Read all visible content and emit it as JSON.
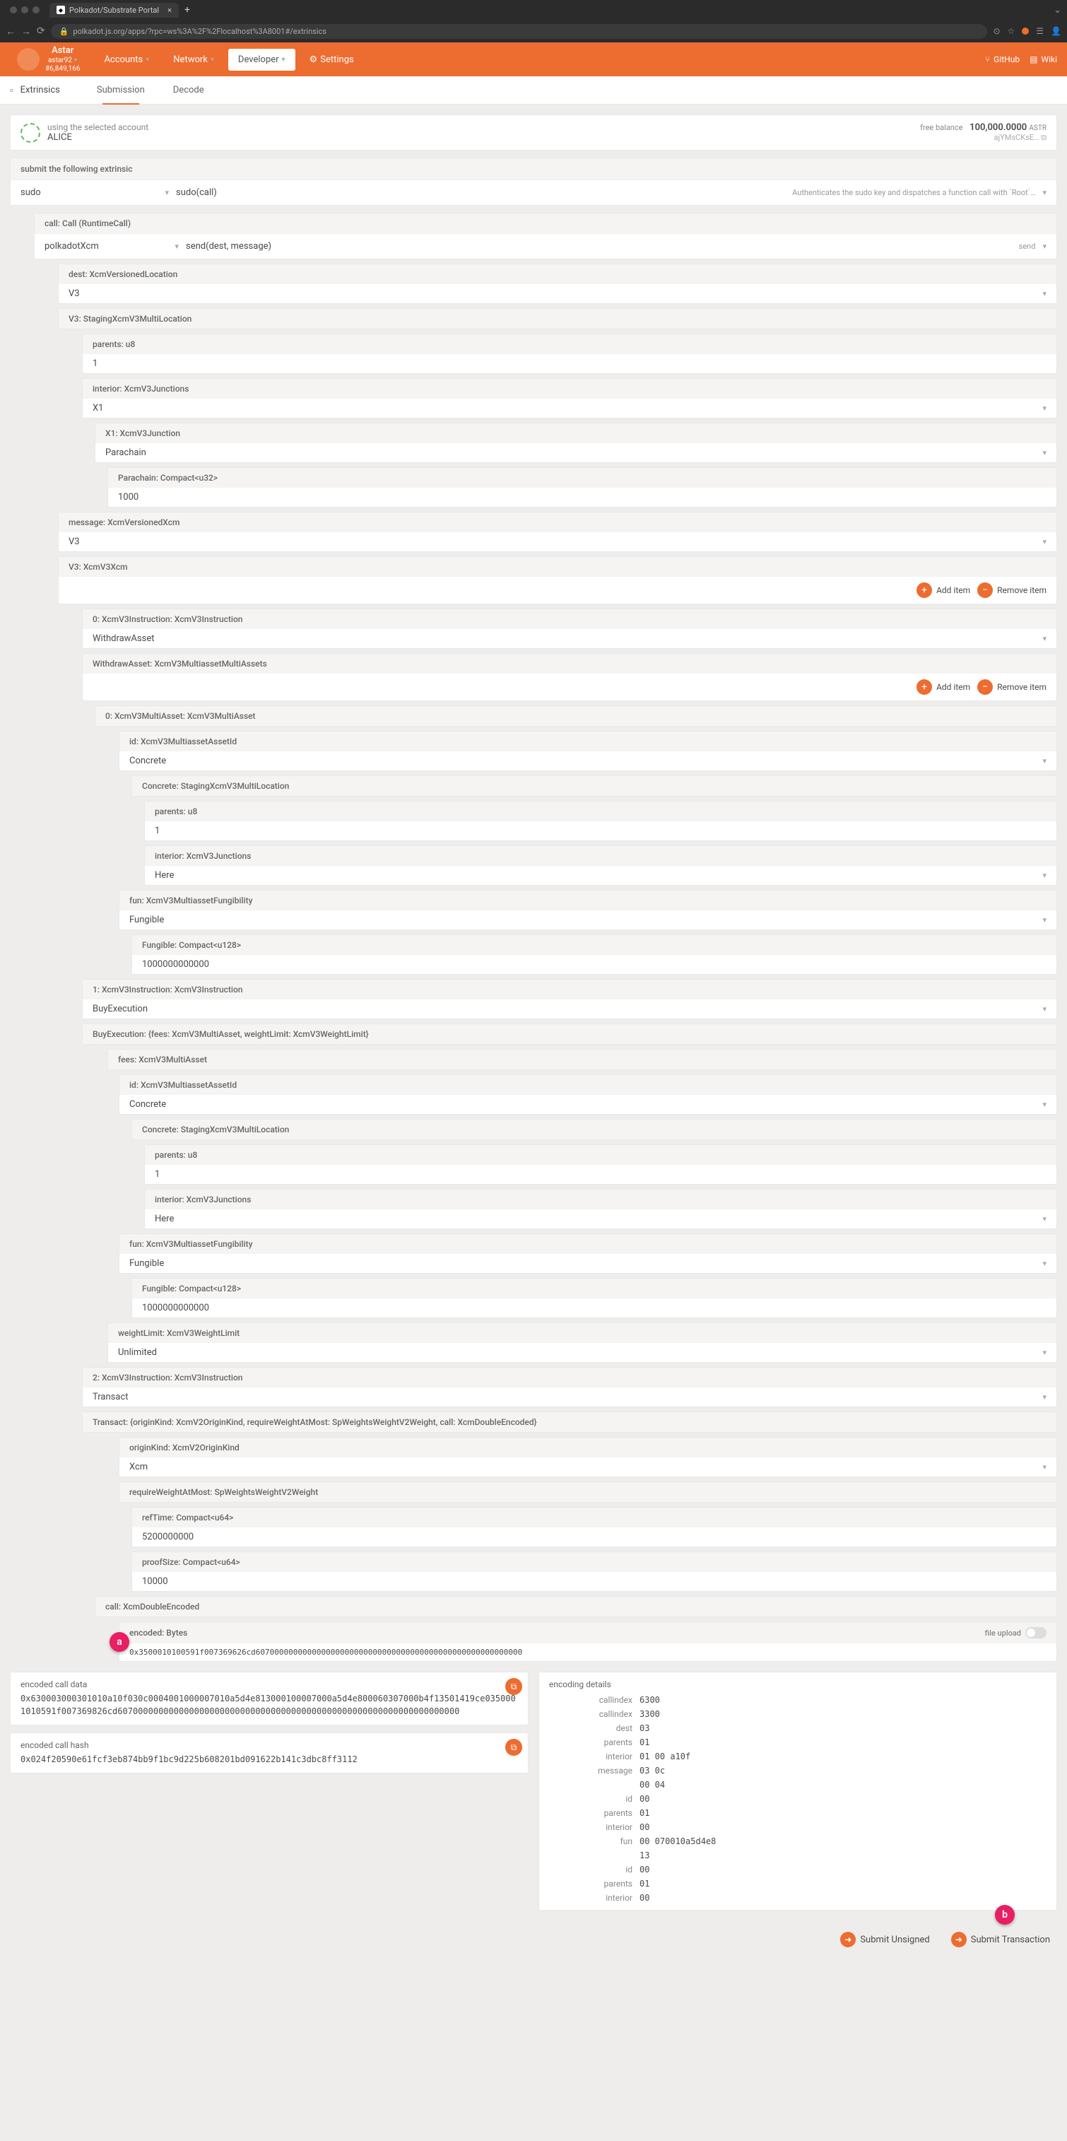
{
  "browser": {
    "tab_title": "Polkadot/Substrate Portal",
    "url": "polkadot.js.org/apps/?rpc=ws%3A%2F%2Flocalhost%3A8001#/extrinsics"
  },
  "nav": {
    "chain_name": "Astar",
    "chain_sub": "astar92",
    "block": "#6,849,166",
    "items": [
      "Accounts",
      "Network",
      "Developer",
      "Settings"
    ],
    "github": "GitHub",
    "wiki": "Wiki"
  },
  "subnav": {
    "label": "Extrinsics",
    "tabs": [
      "Submission",
      "Decode"
    ]
  },
  "account": {
    "label": "using the selected account",
    "name": "ALICE",
    "bal_label": "free balance",
    "bal_val": "100,000.0000",
    "bal_unit": "ASTR",
    "addr": "ajYMsCKsE…"
  },
  "form": {
    "header": "submit the following extrinsic",
    "module": "sudo",
    "method": "sudo(call)",
    "hint": "Authenticates the sudo key and dispatches a function call with `Root`…",
    "call_label": "call: Call (RuntimeCall)",
    "call_module": "polkadotXcm",
    "call_method": "send(dest, message)",
    "call_hint": "send"
  },
  "dest": {
    "label": "dest: XcmVersionedLocation",
    "value": "V3",
    "v3_label": "V3: StagingXcmV3MultiLocation",
    "parents_label": "parents: u8",
    "parents_val": "1",
    "interior_label": "interior: XcmV3Junctions",
    "interior_val": "X1",
    "x1_label": "X1: XcmV3Junction",
    "x1_val": "Parachain",
    "para_label": "Parachain: Compact<u32>",
    "para_val": "1000"
  },
  "msg": {
    "label": "message: XcmVersionedXcm",
    "value": "V3",
    "v3_label": "V3: XcmV3Xcm",
    "add": "Add item",
    "remove": "Remove item"
  },
  "instr0": {
    "label": "0: XcmV3Instruction: XcmV3Instruction",
    "value": "WithdrawAsset",
    "wa_label": "WithdrawAsset: XcmV3MultiassetMultiAssets",
    "asset0_label": "0: XcmV3MultiAsset: XcmV3MultiAsset",
    "id_label": "id: XcmV3MultiassetAssetId",
    "id_val": "Concrete",
    "concrete_label": "Concrete: StagingXcmV3MultiLocation",
    "parents_label": "parents: u8",
    "parents_val": "1",
    "interior_label": "interior: XcmV3Junctions",
    "interior_val": "Here",
    "fun_label": "fun: XcmV3MultiassetFungibility",
    "fun_val": "Fungible",
    "fung_label": "Fungible: Compact<u128>",
    "fung_val": "1000000000000"
  },
  "instr1": {
    "label": "1: XcmV3Instruction: XcmV3Instruction",
    "value": "BuyExecution",
    "be_label": "BuyExecution: {fees: XcmV3MultiAsset, weightLimit: XcmV3WeightLimit}",
    "fees_label": "fees: XcmV3MultiAsset",
    "id_label": "id: XcmV3MultiassetAssetId",
    "id_val": "Concrete",
    "concrete_label": "Concrete: StagingXcmV3MultiLocation",
    "parents_label": "parents: u8",
    "parents_val": "1",
    "interior_label": "interior: XcmV3Junctions",
    "interior_val": "Here",
    "fun_label": "fun: XcmV3MultiassetFungibility",
    "fun_val": "Fungible",
    "fung_label": "Fungible: Compact<u128>",
    "fung_val": "1000000000000",
    "wl_label": "weightLimit: XcmV3WeightLimit",
    "wl_val": "Unlimited"
  },
  "instr2": {
    "label": "2: XcmV3Instruction: XcmV3Instruction",
    "value": "Transact",
    "tr_label": "Transact: {originKind: XcmV2OriginKind, requireWeightAtMost: SpWeightsWeightV2Weight, call: XcmDoubleEncoded}",
    "ok_label": "originKind: XcmV2OriginKind",
    "ok_val": "Xcm",
    "rw_label": "requireWeightAtMost: SpWeightsWeightV2Weight",
    "rt_label": "refTime: Compact<u64>",
    "rt_val": "5200000000",
    "ps_label": "proofSize: Compact<u64>",
    "ps_val": "10000",
    "call_label": "call: XcmDoubleEncoded",
    "enc_label": "encoded: Bytes",
    "enc_val": "0x3500010100591f007369626cd607000000000000000000000000000000000000000000000000000000",
    "upload": "file upload"
  },
  "encoded": {
    "data_label": "encoded call data",
    "data_val": "0x630003000301010a10f030c0004001000007010a5d4e813000100007000a5d4e800060307000b4f13501419ce0350001010591f007369826cd6070000000000000000000000000000000000000000000000000000000000000000",
    "hash_label": "encoded call hash",
    "hash_val": "0x024f20590e61fcf3eb874bb9f1bc9d225b608201bd091622b141c3dbc8ff3112"
  },
  "details": {
    "title": "encoding details",
    "rows": [
      [
        "callindex",
        "6300"
      ],
      [
        "callindex",
        "3300"
      ],
      [
        "dest",
        "03"
      ],
      [
        "parents",
        "01"
      ],
      [
        "interior",
        "01 00 a10f"
      ],
      [
        "message",
        "03 0c"
      ],
      [
        "",
        "00 04"
      ],
      [
        "id",
        "00"
      ],
      [
        "parents",
        "01"
      ],
      [
        "interior",
        "00"
      ],
      [
        "fun",
        "00 070010a5d4e8"
      ],
      [
        "",
        "13"
      ],
      [
        "id",
        "00"
      ],
      [
        "parents",
        "01"
      ],
      [
        "interior",
        "00"
      ]
    ]
  },
  "submit": {
    "unsigned": "Submit Unsigned",
    "tx": "Submit Transaction"
  }
}
